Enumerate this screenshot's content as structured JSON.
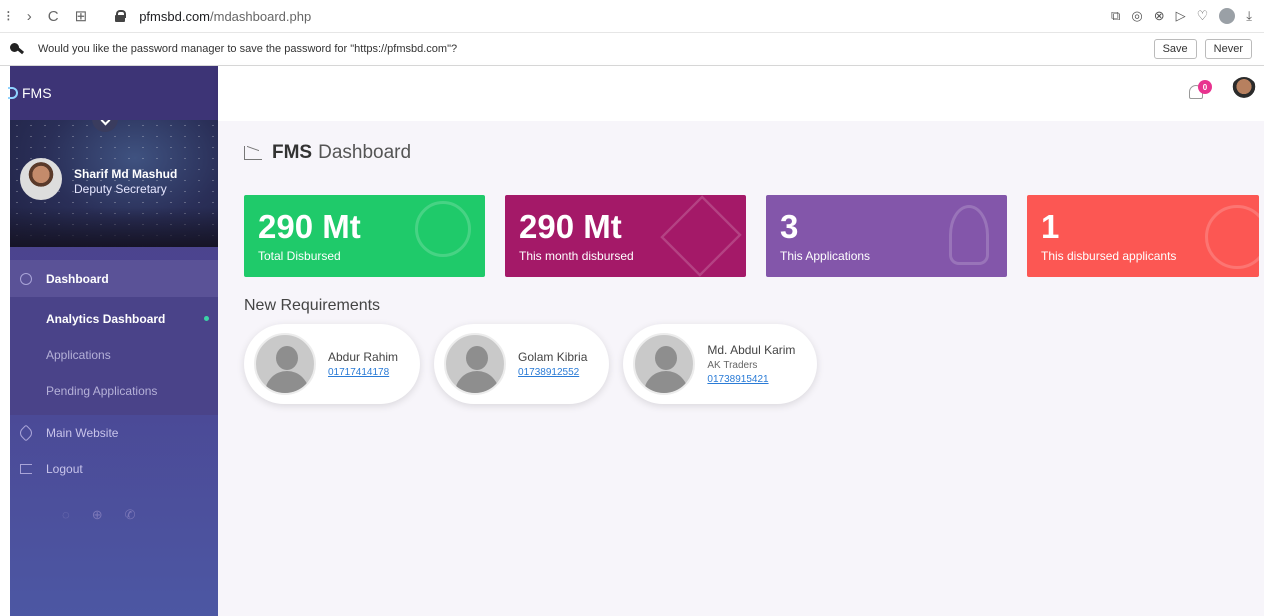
{
  "browser": {
    "nav_glyphs": [
      "⁝",
      "›",
      "C",
      "⊞"
    ],
    "url_host": "pfmsbd.com",
    "url_path": "/mdashboard.php",
    "right_glyphs": [
      "⧉",
      "◎",
      "⊗",
      "▷",
      "♡"
    ],
    "download_glyph": "⤓"
  },
  "password_bar": {
    "message": "Would you like the password manager to save the password for \"https://pfmsbd.com\"?",
    "save_label": "Save",
    "never_label": "Never"
  },
  "sidebar": {
    "brand": "FMS",
    "user_name": "Sharif Md Mashud",
    "user_role": "Deputy Secretary",
    "dashboard_label": "Dashboard",
    "sub_items": [
      "Analytics Dashboard",
      "Applications",
      "Pending Applications"
    ],
    "main_website_label": "Main Website",
    "logout_label": "Logout",
    "footer_glyphs": [
      "◌",
      "⊕",
      "✆"
    ]
  },
  "topbar": {
    "notification_count": "0"
  },
  "main": {
    "title_bold": "FMS",
    "title_rest": "Dashboard",
    "cards": [
      {
        "value": "290 Mt",
        "label": "Total Disbursed"
      },
      {
        "value": "290 Mt",
        "label": "This month disbursed"
      },
      {
        "value": "3",
        "label": "This Applications"
      },
      {
        "value": "1",
        "label": "This disbursed applicants"
      }
    ],
    "new_requirements_heading": "New Requirements",
    "requirements": [
      {
        "name": "Abdur Rahim",
        "company": "",
        "phone": "01717414178"
      },
      {
        "name": "Golam Kibria",
        "company": "",
        "phone": "01738912552"
      },
      {
        "name": "Md. Abdul Karim",
        "company": "AK Traders",
        "phone": "01738915421"
      }
    ]
  },
  "colors": {
    "card_green": "#1fca6a",
    "card_magenta": "#a41968",
    "card_purple": "#8356aa",
    "card_red": "#fc5753",
    "sidebar": "#4b4794",
    "badge": "#e8338f"
  }
}
